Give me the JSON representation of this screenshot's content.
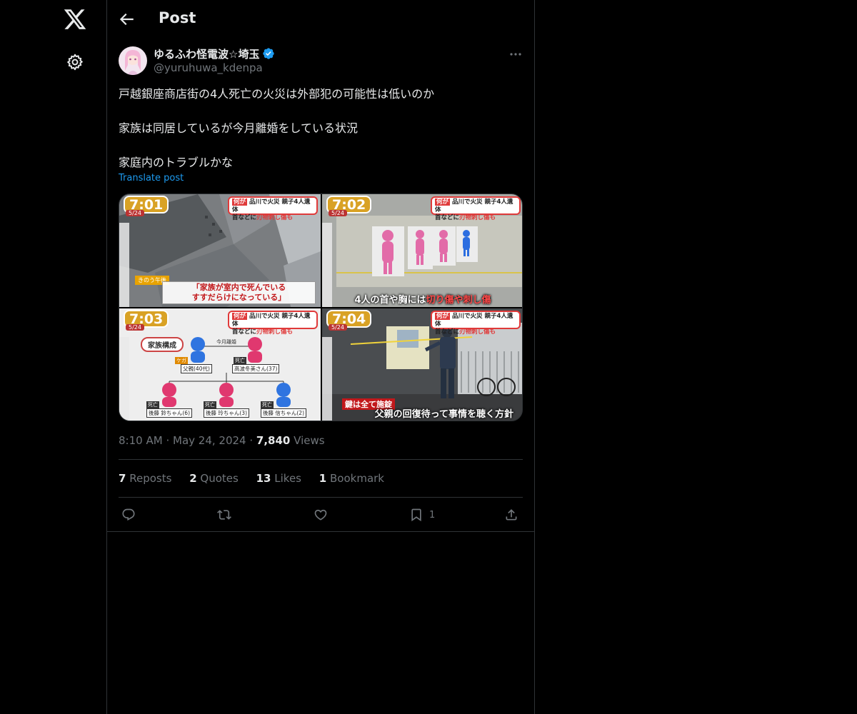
{
  "nav": {
    "logo_icon": "x-logo-icon",
    "settings_icon": "gear-icon"
  },
  "header": {
    "title": "Post",
    "back_icon": "arrow-left-icon"
  },
  "author": {
    "display_name": "ゆるふわ怪電波☆埼玉",
    "handle": "@yuruhuwa_kdenpa",
    "verified": true
  },
  "post": {
    "lines": [
      "戸越銀座商店街の4人死亡の火災は外部犯の可能性は低いのか",
      "家族は同居しているが今月離婚をしている状況",
      "家庭内のトラブルかな"
    ],
    "translate_label": "Translate post"
  },
  "media": [
    {
      "time": "7:01",
      "date": "5/24",
      "headline_tag": "何が",
      "headline_line1": "品川で火災 親子4人遺体",
      "headline_line2_pre": "首などに",
      "headline_line2_red": "刃物刺し傷も",
      "tag": "きのう午後",
      "caption_line1": "「家族が室内で死んでいる",
      "caption_line2": "すすだらけになっている」"
    },
    {
      "time": "7:02",
      "date": "5/24",
      "headline_tag": "何が",
      "headline_line1": "品川で火災 親子4人遺体",
      "headline_line2_pre": "首などに",
      "headline_line2_red": "刃物刺し傷も",
      "caption_pre": "4人の首や胸には",
      "caption_red": "切り傷や刺し傷"
    },
    {
      "time": "7:03",
      "date": "5/24",
      "headline_tag": "何が",
      "headline_line1": "品川で火災 親子4人遺体",
      "headline_line2_pre": "首などに",
      "headline_line2_red": "刃物刺し傷も",
      "tree_title": "家族構成",
      "tree_note": "今月離婚",
      "tree_hurt": "ケガ",
      "tree_dead": "死亡",
      "father": "父親(40代)",
      "mother": "高波冬美さん(37)",
      "child1": "後藤 鈴ちゃん(6)",
      "child2": "後藤 玲ちゃん(3)",
      "child3": "後藤 信ちゃん(2)"
    },
    {
      "time": "7:04",
      "date": "5/24",
      "headline_tag": "何が",
      "headline_line1": "品川で火災 親子4人遺体",
      "headline_line2_pre": "首などに",
      "headline_line2_red": "刃物刺し傷も",
      "red_label": "鍵は全て施錠",
      "caption": "父親の回復待って事情を聴く方針"
    }
  ],
  "meta": {
    "time": "8:10 AM",
    "date": "May 24, 2024",
    "views_count": "7,840",
    "views_label": "Views",
    "separator": "·"
  },
  "stats": {
    "reposts_count": "7",
    "reposts_label": "Reposts",
    "quotes_count": "2",
    "quotes_label": "Quotes",
    "likes_count": "13",
    "likes_label": "Likes",
    "bookmarks_count": "1",
    "bookmarks_label": "Bookmark"
  },
  "actions": {
    "bookmark_count": "1"
  },
  "colors": {
    "background": "#000000",
    "text": "#e7e9ea",
    "muted": "#71767b",
    "accent": "#1d9bf0",
    "border": "#2f3336"
  }
}
